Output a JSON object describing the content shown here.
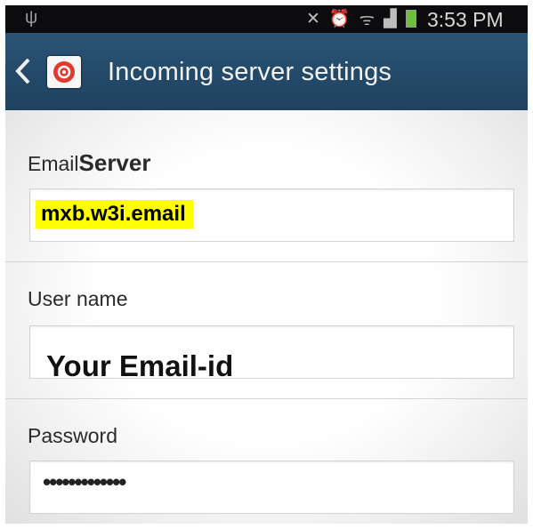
{
  "status_bar": {
    "time": "3:53 PM",
    "icons": [
      "usb-icon",
      "muted-icon",
      "alarm-icon",
      "wifi-icon",
      "signal-icon",
      "battery-icon"
    ]
  },
  "action_bar": {
    "title": "Incoming server settings",
    "back_icon": "chevron-left-icon",
    "app_icon": "email-app-icon"
  },
  "form": {
    "server": {
      "label_prefix": "Email",
      "label_bold": "Server",
      "value": "mxb.w3i.email"
    },
    "username": {
      "label": "User name",
      "value": "Your Email-id"
    },
    "password": {
      "label": "Password",
      "value": "•••••••••••••"
    }
  },
  "colors": {
    "action_bar": "#2a5375",
    "highlight": "#ffff00",
    "status_bar": "#0c0c0f"
  }
}
